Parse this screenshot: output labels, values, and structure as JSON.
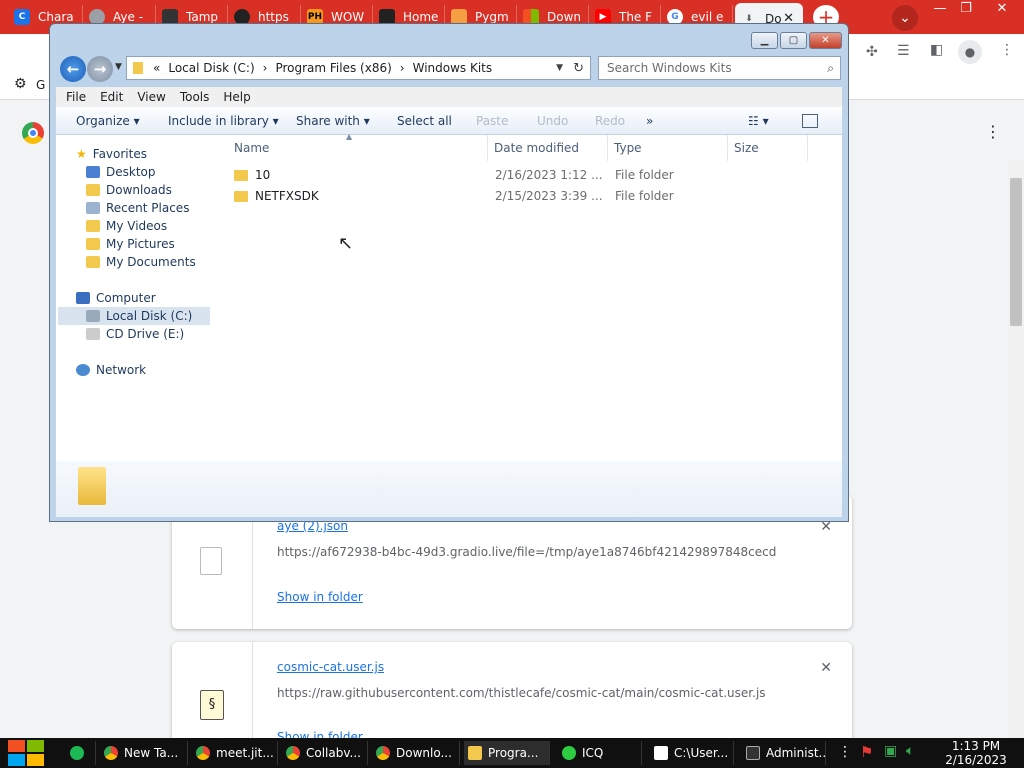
{
  "chrome": {
    "tabs": [
      {
        "label": "Chara",
        "icon": "book-icon"
      },
      {
        "label": "Aye -",
        "icon": "chrome-icon"
      },
      {
        "label": "Tamp",
        "icon": "tampermonkey-icon"
      },
      {
        "label": "https",
        "icon": "github-icon"
      },
      {
        "label": "WOW",
        "icon": "ph-icon"
      },
      {
        "label": "Home",
        "icon": "home-icon"
      },
      {
        "label": "Pygm",
        "icon": "pygmalion-icon"
      },
      {
        "label": "Down",
        "icon": "microsoft-icon"
      },
      {
        "label": "The F",
        "icon": "youtube-icon"
      },
      {
        "label": "evil e",
        "icon": "google-icon"
      },
      {
        "label": "Do",
        "icon": "download-icon",
        "active": true
      }
    ],
    "new_tab": "+",
    "bookmark_label": "G"
  },
  "downloads": {
    "items": [
      {
        "filename": "aye (2).json",
        "url": "https://af672938-b4bc-49d3.gradio.live/file=/tmp/aye1a8746bf421429897848cecde...",
        "action": "Show in folder"
      },
      {
        "filename": "cosmic-cat.user.js",
        "url": "https://raw.githubusercontent.com/thistlecafe/cosmic-cat/main/cosmic-cat.user.js",
        "action": "Show in folder"
      }
    ]
  },
  "explorer": {
    "address": {
      "prefix": "«",
      "segments": [
        "Local Disk (C:)",
        "Program Files (x86)",
        "Windows Kits"
      ]
    },
    "search_placeholder": "Search Windows Kits",
    "menu": [
      "File",
      "Edit",
      "View",
      "Tools",
      "Help"
    ],
    "commands": {
      "organize": "Organize",
      "include": "Include in library",
      "share": "Share with",
      "select_all": "Select all",
      "paste": "Paste",
      "undo": "Undo",
      "redo": "Redo",
      "more": "»"
    },
    "nav": {
      "favorites": "Favorites",
      "favorite_items": [
        "Desktop",
        "Downloads",
        "Recent Places",
        "My Videos",
        "My Pictures",
        "My Documents"
      ],
      "computer": "Computer",
      "computer_items": [
        "Local Disk (C:)",
        "CD Drive (E:)"
      ],
      "network": "Network"
    },
    "columns": [
      "Name",
      "Date modified",
      "Type",
      "Size"
    ],
    "files": [
      {
        "name": "10",
        "date": "2/16/2023 1:12 ...",
        "type": "File folder",
        "size": ""
      },
      {
        "name": "NETFXSDK",
        "date": "2/15/2023 3:39 ...",
        "type": "File folder",
        "size": ""
      }
    ]
  },
  "taskbar": {
    "items": [
      {
        "label": "",
        "icon": "green-app-icon"
      },
      {
        "label": "New Ta...",
        "icon": "chrome-icon"
      },
      {
        "label": "meet.jit...",
        "icon": "chrome-icon"
      },
      {
        "label": "Collabv...",
        "icon": "chrome-icon"
      },
      {
        "label": "Downlo...",
        "icon": "chrome-icon"
      },
      {
        "label": "Progra...",
        "icon": "folder-icon"
      },
      {
        "label": "ICQ",
        "icon": "icq-icon"
      },
      {
        "label": "C:\\User...",
        "icon": "7zip-icon"
      },
      {
        "label": "Administ...",
        "icon": "cmd-icon"
      }
    ],
    "time": "1:13 PM",
    "date": "2/16/2023"
  }
}
